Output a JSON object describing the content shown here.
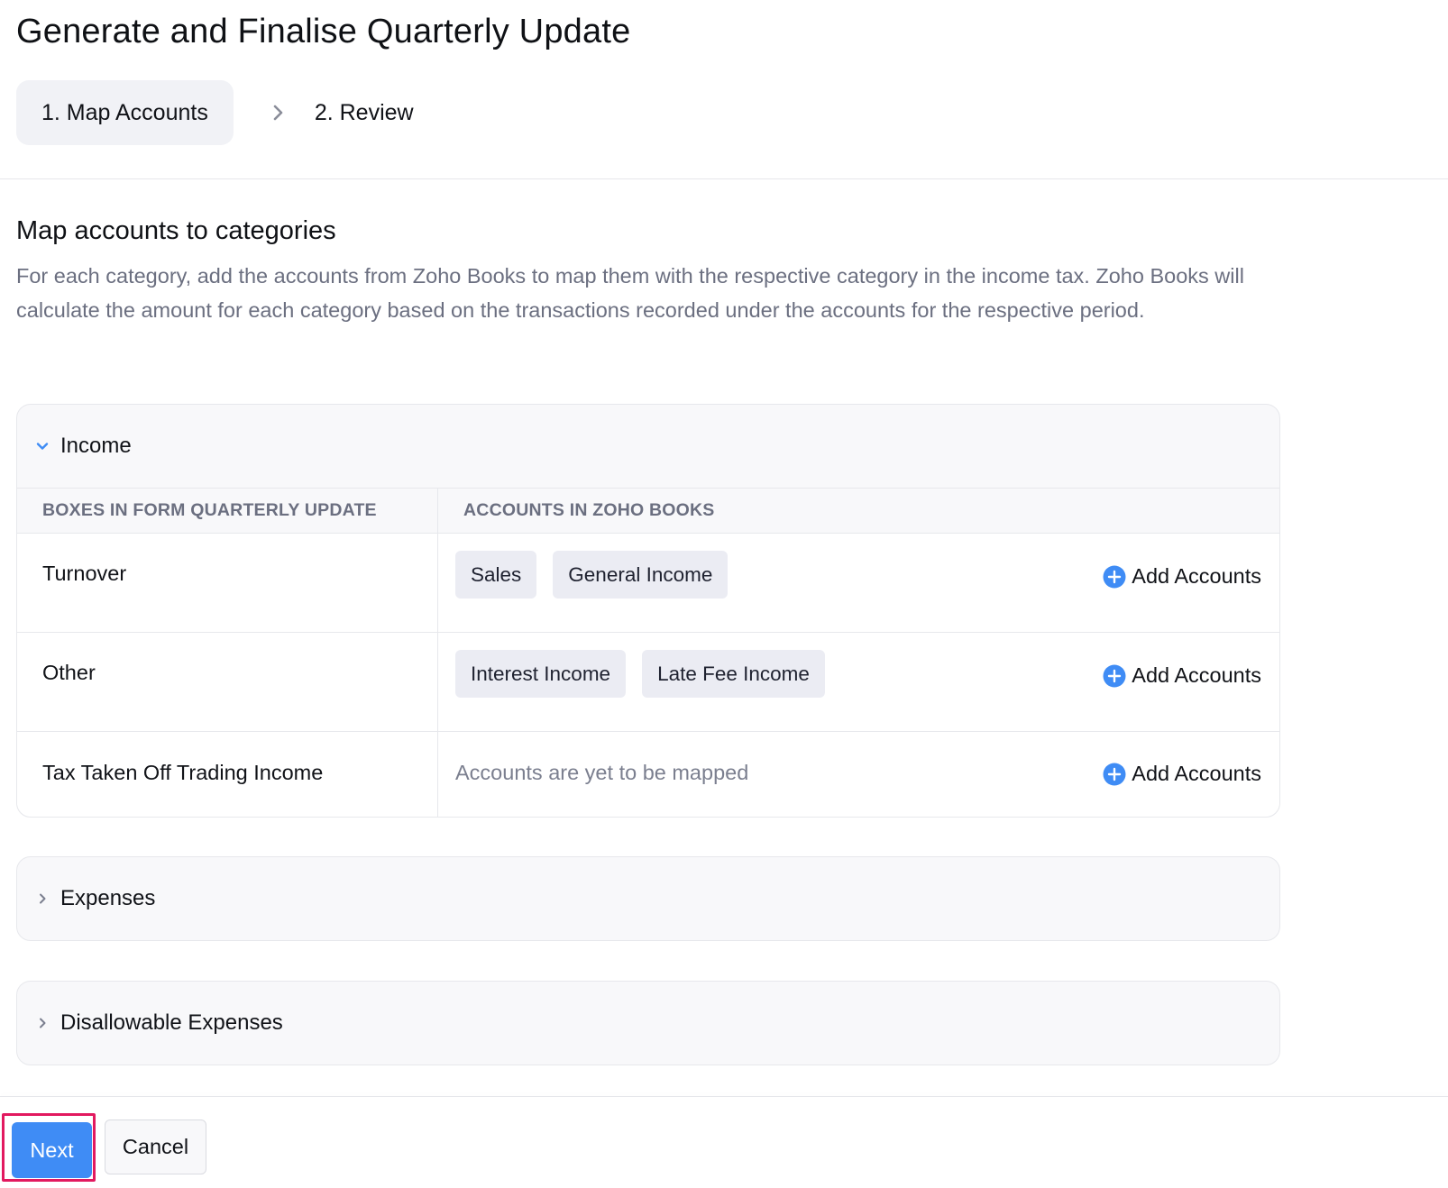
{
  "page": {
    "title": "Generate and Finalise Quarterly Update"
  },
  "steps": [
    {
      "label": "1. Map Accounts",
      "active": true
    },
    {
      "label": "2. Review",
      "active": false
    }
  ],
  "section": {
    "title": "Map accounts to categories",
    "description": "For each category, add the accounts from Zoho Books to map them with the respective category in the income tax. Zoho Books will calculate the amount for each category based on the transactions recorded under the accounts for the respective period."
  },
  "income": {
    "label": "Income",
    "expanded": true,
    "headers": {
      "col1": "BOXES IN FORM QUARTERLY UPDATE",
      "col2": "ACCOUNTS IN ZOHO BOOKS"
    },
    "rows": [
      {
        "box": "Turnover",
        "accounts": [
          "Sales",
          "General Income"
        ],
        "add_label": "Add Accounts"
      },
      {
        "box": "Other",
        "accounts": [
          "Interest Income",
          "Late Fee Income"
        ],
        "add_label": "Add Accounts"
      },
      {
        "box": "Tax Taken Off Trading Income",
        "empty_text": "Accounts are yet to be mapped",
        "add_label": "Add Accounts"
      }
    ]
  },
  "expenses": {
    "label": "Expenses",
    "expanded": false
  },
  "disallowable": {
    "label": "Disallowable Expenses",
    "expanded": false
  },
  "footer": {
    "next_label": "Next",
    "cancel_label": "Cancel"
  },
  "colors": {
    "accent": "#3f8cf5",
    "highlight": "#e2195f",
    "chip_bg": "#ebecf3",
    "muted_text": "#6b6f80"
  },
  "icons": {
    "expanded": "chevron-down-icon",
    "collapsed": "chevron-right-icon",
    "add": "plus-circle-icon",
    "step_separator": "chevron-right-icon"
  }
}
